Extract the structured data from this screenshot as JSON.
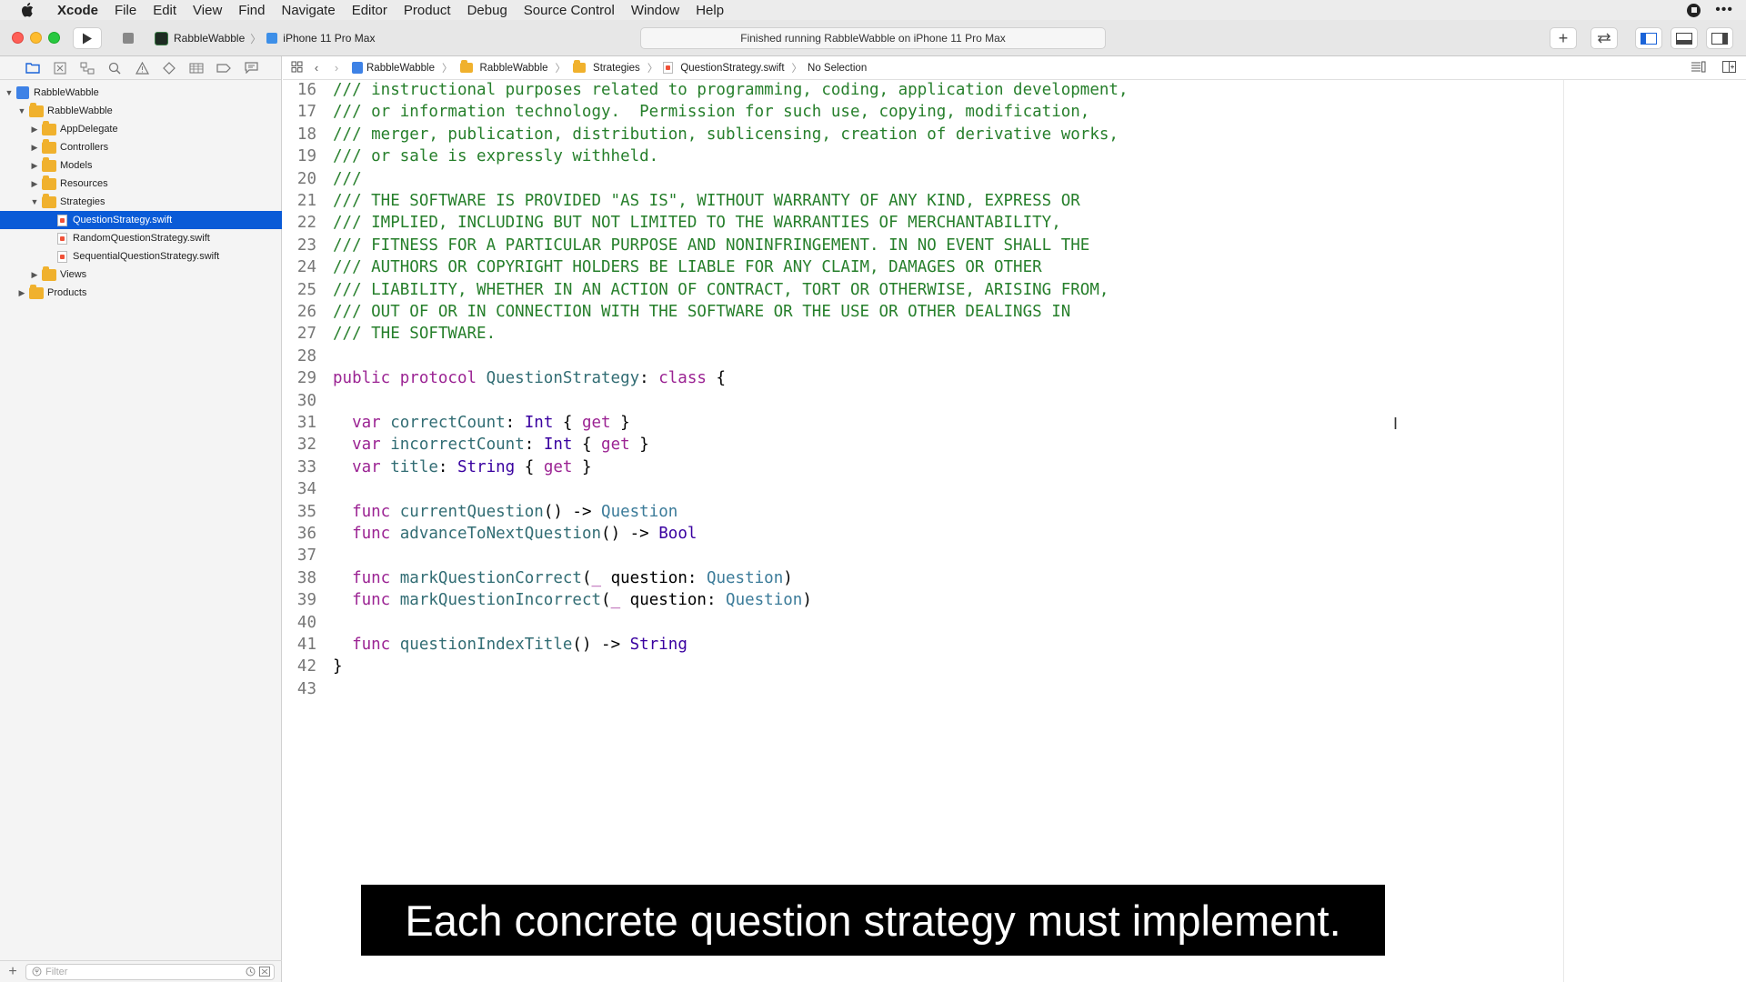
{
  "menubar": {
    "items": [
      "Xcode",
      "File",
      "Edit",
      "View",
      "Find",
      "Navigate",
      "Editor",
      "Product",
      "Debug",
      "Source Control",
      "Window",
      "Help"
    ]
  },
  "toolbar": {
    "scheme": "RabbleWabble",
    "device": "iPhone 11 Pro Max",
    "status": "Finished running RabbleWabble on iPhone 11 Pro Max"
  },
  "navigator": {
    "rows": [
      {
        "label": "RabbleWabble",
        "kind": "project",
        "indent": 0,
        "disclosure": "open"
      },
      {
        "label": "RabbleWabble",
        "kind": "folder",
        "indent": 1,
        "disclosure": "open"
      },
      {
        "label": "AppDelegate",
        "kind": "folder",
        "indent": 2,
        "disclosure": "closed"
      },
      {
        "label": "Controllers",
        "kind": "folder",
        "indent": 2,
        "disclosure": "closed"
      },
      {
        "label": "Models",
        "kind": "folder",
        "indent": 2,
        "disclosure": "closed"
      },
      {
        "label": "Resources",
        "kind": "folder",
        "indent": 2,
        "disclosure": "closed"
      },
      {
        "label": "Strategies",
        "kind": "folder",
        "indent": 2,
        "disclosure": "open"
      },
      {
        "label": "QuestionStrategy.swift",
        "kind": "file",
        "indent": 3,
        "disclosure": "none",
        "selected": true
      },
      {
        "label": "RandomQuestionStrategy.swift",
        "kind": "file",
        "indent": 3,
        "disclosure": "none"
      },
      {
        "label": "SequentialQuestionStrategy.swift",
        "kind": "file",
        "indent": 3,
        "disclosure": "none"
      },
      {
        "label": "Views",
        "kind": "folder",
        "indent": 2,
        "disclosure": "closed"
      },
      {
        "label": "Products",
        "kind": "folder",
        "indent": 1,
        "disclosure": "closed"
      }
    ],
    "filter_placeholder": "Filter"
  },
  "jumpbar": {
    "crumbs": [
      "RabbleWabble",
      "RabbleWabble",
      "Strategies",
      "QuestionStrategy.swift",
      "No Selection"
    ]
  },
  "code": [
    {
      "n": "16",
      "tokens": [
        [
          "cm",
          "/// instructional purposes related to programming, coding, application development,"
        ]
      ]
    },
    {
      "n": "17",
      "tokens": [
        [
          "cm",
          "/// or information technology.  Permission for such use, copying, modification,"
        ]
      ]
    },
    {
      "n": "18",
      "tokens": [
        [
          "cm",
          "/// merger, publication, distribution, sublicensing, creation of derivative works,"
        ]
      ]
    },
    {
      "n": "19",
      "tokens": [
        [
          "cm",
          "/// or sale is expressly withheld."
        ]
      ]
    },
    {
      "n": "20",
      "tokens": [
        [
          "cm",
          "///"
        ]
      ]
    },
    {
      "n": "21",
      "tokens": [
        [
          "cm",
          "/// THE SOFTWARE IS PROVIDED \"AS IS\", WITHOUT WARRANTY OF ANY KIND, EXPRESS OR"
        ]
      ]
    },
    {
      "n": "22",
      "tokens": [
        [
          "cm",
          "/// IMPLIED, INCLUDING BUT NOT LIMITED TO THE WARRANTIES OF MERCHANTABILITY,"
        ]
      ]
    },
    {
      "n": "23",
      "tokens": [
        [
          "cm",
          "/// FITNESS FOR A PARTICULAR PURPOSE AND NONINFRINGEMENT. IN NO EVENT SHALL THE"
        ]
      ]
    },
    {
      "n": "24",
      "tokens": [
        [
          "cm",
          "/// AUTHORS OR COPYRIGHT HOLDERS BE LIABLE FOR ANY CLAIM, DAMAGES OR OTHER"
        ]
      ]
    },
    {
      "n": "25",
      "tokens": [
        [
          "cm",
          "/// LIABILITY, WHETHER IN AN ACTION OF CONTRACT, TORT OR OTHERWISE, ARISING FROM,"
        ]
      ]
    },
    {
      "n": "26",
      "tokens": [
        [
          "cm",
          "/// OUT OF OR IN CONNECTION WITH THE SOFTWARE OR THE USE OR OTHER DEALINGS IN"
        ]
      ]
    },
    {
      "n": "27",
      "tokens": [
        [
          "cm",
          "/// THE SOFTWARE."
        ]
      ]
    },
    {
      "n": "28",
      "tokens": []
    },
    {
      "n": "29",
      "tokens": [
        [
          "kw",
          "public protocol "
        ],
        [
          "id",
          "QuestionStrategy"
        ],
        [
          "pl",
          ": "
        ],
        [
          "kw",
          "class"
        ],
        [
          "pl",
          " {"
        ]
      ]
    },
    {
      "n": "30",
      "tokens": []
    },
    {
      "n": "31",
      "tokens": [
        [
          "pl",
          "  "
        ],
        [
          "kw",
          "var "
        ],
        [
          "id",
          "correctCount"
        ],
        [
          "pl",
          ": "
        ],
        [
          "ty",
          "Int"
        ],
        [
          "pl",
          " { "
        ],
        [
          "kw",
          "get"
        ],
        [
          "pl",
          " }"
        ]
      ]
    },
    {
      "n": "32",
      "tokens": [
        [
          "pl",
          "  "
        ],
        [
          "kw",
          "var "
        ],
        [
          "id",
          "incorrectCount"
        ],
        [
          "pl",
          ": "
        ],
        [
          "ty",
          "Int"
        ],
        [
          "pl",
          " { "
        ],
        [
          "kw",
          "get"
        ],
        [
          "pl",
          " }"
        ]
      ]
    },
    {
      "n": "33",
      "tokens": [
        [
          "pl",
          "  "
        ],
        [
          "kw",
          "var "
        ],
        [
          "id",
          "title"
        ],
        [
          "pl",
          ": "
        ],
        [
          "ty",
          "String"
        ],
        [
          "pl",
          " { "
        ],
        [
          "kw",
          "get"
        ],
        [
          "pl",
          " }"
        ]
      ]
    },
    {
      "n": "34",
      "tokens": []
    },
    {
      "n": "35",
      "tokens": [
        [
          "pl",
          "  "
        ],
        [
          "kw",
          "func "
        ],
        [
          "id",
          "currentQuestion"
        ],
        [
          "pl",
          "() -> "
        ],
        [
          "ty2",
          "Question"
        ]
      ]
    },
    {
      "n": "36",
      "tokens": [
        [
          "pl",
          "  "
        ],
        [
          "kw",
          "func "
        ],
        [
          "id",
          "advanceToNextQuestion"
        ],
        [
          "pl",
          "() -> "
        ],
        [
          "ty",
          "Bool"
        ]
      ]
    },
    {
      "n": "37",
      "tokens": []
    },
    {
      "n": "38",
      "tokens": [
        [
          "pl",
          "  "
        ],
        [
          "kw",
          "func "
        ],
        [
          "id",
          "markQuestionCorrect"
        ],
        [
          "pl",
          "("
        ],
        [
          "kw",
          "_"
        ],
        [
          "pl",
          " question: "
        ],
        [
          "ty2",
          "Question"
        ],
        [
          "pl",
          ")"
        ]
      ]
    },
    {
      "n": "39",
      "tokens": [
        [
          "pl",
          "  "
        ],
        [
          "kw",
          "func "
        ],
        [
          "id",
          "markQuestionIncorrect"
        ],
        [
          "pl",
          "("
        ],
        [
          "kw",
          "_"
        ],
        [
          "pl",
          " question: "
        ],
        [
          "ty2",
          "Question"
        ],
        [
          "pl",
          ")"
        ]
      ]
    },
    {
      "n": "40",
      "tokens": []
    },
    {
      "n": "41",
      "tokens": [
        [
          "pl",
          "  "
        ],
        [
          "kw",
          "func "
        ],
        [
          "id",
          "questionIndexTitle"
        ],
        [
          "pl",
          "() -> "
        ],
        [
          "ty",
          "String"
        ]
      ]
    },
    {
      "n": "42",
      "tokens": [
        [
          "pl",
          "}"
        ]
      ]
    },
    {
      "n": "43",
      "tokens": []
    }
  ],
  "caption": "Each concrete question strategy must implement.",
  "colors": {
    "selection": "#0a5bd7",
    "comment": "#267f2b",
    "keyword": "#9b2393",
    "identifier": "#326d74",
    "folder": "#f0b12d"
  }
}
